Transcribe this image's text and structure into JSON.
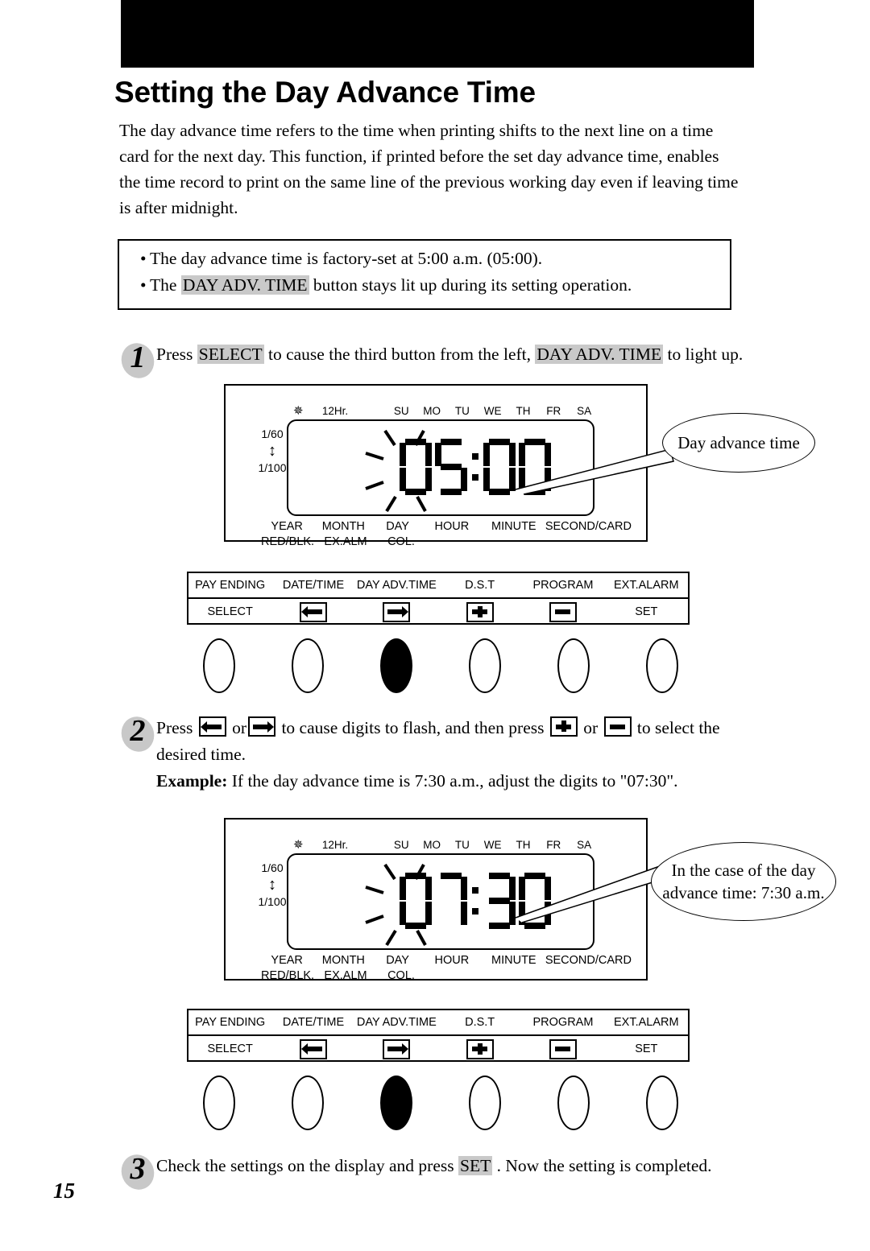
{
  "page": {
    "number": "15",
    "title": "Setting the Day Advance Time",
    "intro": {
      "line1": "The day advance time refers to the time when printing shifts to the next line on a time",
      "line2": "card for the next day.  This function, if printed before the set day advance time, enables",
      "line3": "the time record to print on the same line of the previous working day even if leaving time",
      "line4": "is after midnight."
    }
  },
  "notes": {
    "note1_full": "The day advance time is factory-set at 5:00 a.m. (05:00).",
    "note2_pre": "The ",
    "note2_key": "DAY ADV. TIME",
    "note2_post": " button stays lit up during its setting operation."
  },
  "steps": {
    "step1": {
      "number": "1",
      "pre": "Press ",
      "key1": "SELECT",
      "mid": " to cause the third button from the left, ",
      "key2": "DAY ADV. TIME",
      "post": " to light up."
    },
    "step2": {
      "number": "2",
      "t1": "Press ",
      "t2": " or",
      "t3": " to cause digits to flash, and then press ",
      "t4": " or ",
      "t5": " to select the",
      "line2": "desired time.",
      "example_label": "Example:",
      "example_text": " If the day advance time is 7:30 a.m., adjust the digits to \"07:30\"."
    },
    "step3": {
      "number": "3",
      "pre": "Check the settings on the display and press ",
      "key": "SET",
      "post": " .  Now the setting is completed."
    }
  },
  "lcd": {
    "top_indicators": {
      "gear_icon": "gear-icon",
      "format": "12Hr.",
      "days": [
        "SU",
        "MO",
        "TU",
        "WE",
        "TH",
        "FR",
        "SA"
      ]
    },
    "resolution": {
      "top": "1/60",
      "arrow_icon": "up-down-arrow-icon",
      "bottom": "1/100"
    },
    "bottom_labels_row1": [
      "YEAR",
      "MONTH",
      "DAY",
      "HOUR",
      "MINUTE",
      "SECOND/CARD"
    ],
    "bottom_labels_row2": [
      "RED/BLK.",
      "EX.ALM",
      "COL.",
      "",
      "",
      ""
    ],
    "display1_value": "05:00",
    "display1_digits": [
      "0",
      "5",
      "0",
      "0"
    ],
    "display2_value": "07:30",
    "display2_digits": [
      "0",
      "7",
      "3",
      "0"
    ]
  },
  "callouts": {
    "bubble1": "Day advance time",
    "bubble2_line1": "In the case of the day",
    "bubble2_line2": "advance time: 7:30 a.m."
  },
  "button_panel": {
    "row1": [
      "PAY ENDING",
      "DATE/TIME",
      "DAY ADV.TIME",
      "D.S.T",
      "PROGRAM",
      "EXT.ALARM"
    ],
    "row2_labels": [
      "SELECT",
      "",
      "",
      "",
      "",
      "SET"
    ],
    "row2_icons": [
      "",
      "arrow-left-icon",
      "arrow-right-icon",
      "plus-icon",
      "minus-icon",
      ""
    ],
    "buttons_filled_index": 2
  },
  "colors": {
    "ink": "#000000",
    "paper": "#ffffff",
    "highlight": "#c9c9c9",
    "step_oval": "#c8c8c8"
  }
}
